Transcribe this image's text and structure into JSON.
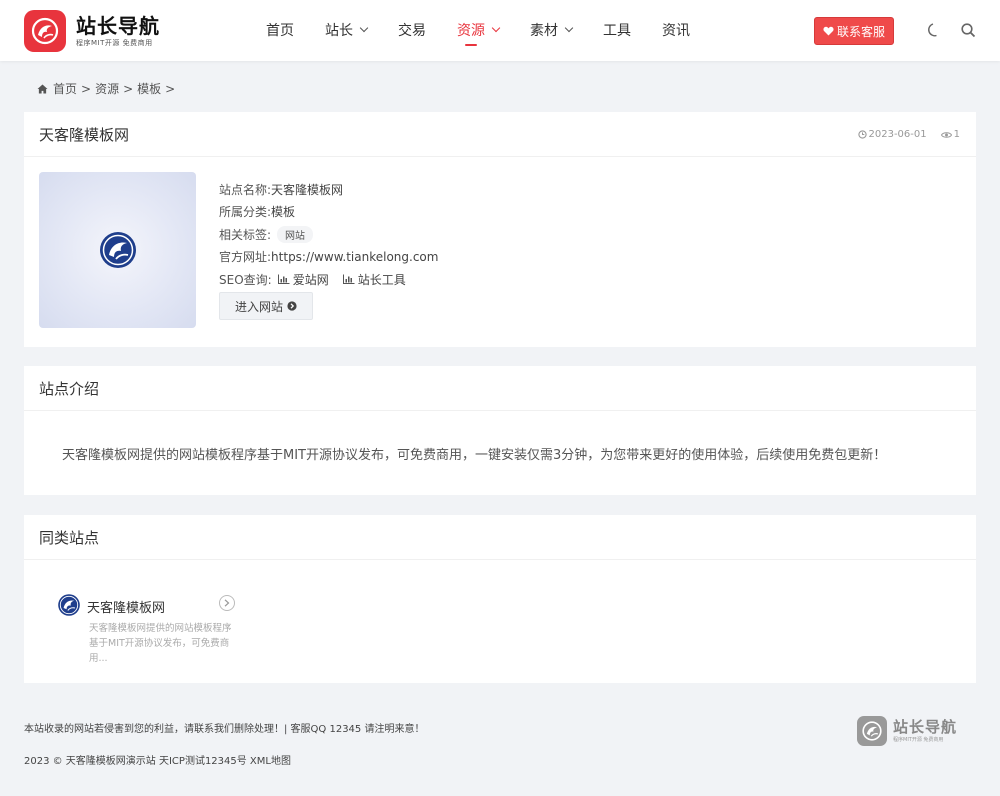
{
  "header": {
    "logo_title": "站长导航",
    "logo_sub": "程序MIT开源 免费商用",
    "nav": [
      {
        "label": "首页",
        "dropdown": false,
        "active": false
      },
      {
        "label": "站长",
        "dropdown": true,
        "active": false
      },
      {
        "label": "交易",
        "dropdown": false,
        "active": false
      },
      {
        "label": "资源",
        "dropdown": true,
        "active": true
      },
      {
        "label": "素材",
        "dropdown": true,
        "active": false
      },
      {
        "label": "工具",
        "dropdown": false,
        "active": false
      },
      {
        "label": "资讯",
        "dropdown": false,
        "active": false
      }
    ],
    "contact_label": "联系客服",
    "accent_color": "#e8343d"
  },
  "breadcrumb": {
    "home": "首页",
    "sep": ">",
    "level1": "资源",
    "level2": "模板",
    "trailing_sep": ">"
  },
  "site": {
    "title": "天客隆模板网",
    "date": "2023-06-01",
    "views": "1",
    "name_label": "站点名称:",
    "name_value": "天客隆模板网",
    "category_label": "所属分类:",
    "category_value": "模板",
    "tags_label": "相关标签:",
    "tag": "网站",
    "url_label": "官方网址:",
    "url_value": "https://www.tiankelong.com",
    "seo_label": "SEO查询:",
    "seo_links": [
      "爱站网",
      "站长工具"
    ],
    "enter_label": "进入网站"
  },
  "intro": {
    "heading": "站点介绍",
    "text": "天客隆模板网提供的网站模板程序基于MIT开源协议发布，可免费商用，一键安装仅需3分钟，为您带来更好的使用体验，后续使用免费包更新！"
  },
  "similar": {
    "heading": "同类站点",
    "items": [
      {
        "title": "天客隆模板网",
        "desc": "天客隆模板网提供的网站模板程序基于MIT开源协议发布，可免费商用..."
      }
    ]
  },
  "footer": {
    "line1": "本站收录的网站若侵害到您的利益，请联系我们删除处理！| 客服QQ 12345 请注明来意！",
    "line2": "2023 © 天客隆模板网演示站 天ICP测试12345号 XML地图",
    "logo_title": "站长导航",
    "logo_sub": "程序MIT开源 免费商用"
  }
}
